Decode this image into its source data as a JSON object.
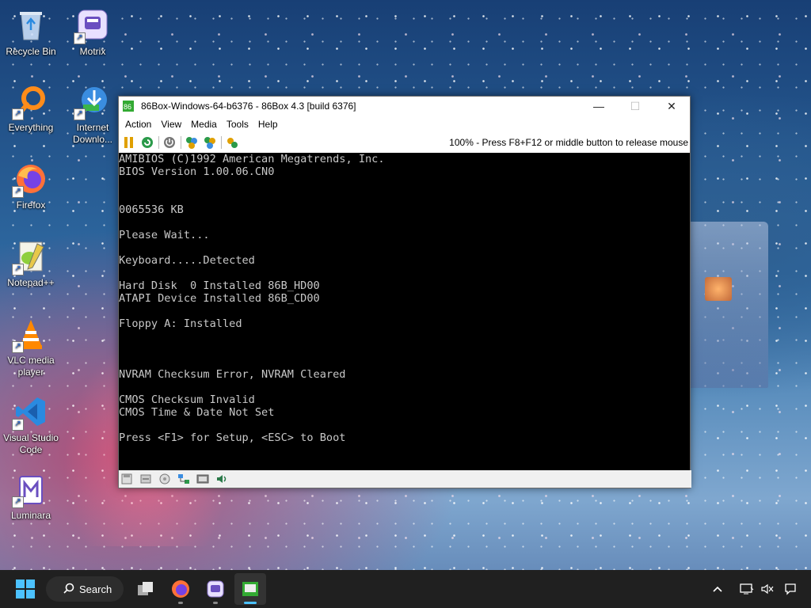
{
  "desktop": {
    "icons": [
      {
        "label": "Recycle Bin",
        "icon": "recycle-bin-icon"
      },
      {
        "label": "Motrix",
        "icon": "motrix-icon"
      },
      {
        "label": "Everything",
        "icon": "everything-search-icon"
      },
      {
        "label": "Internet Downlo...",
        "icon": "internet-download-manager-icon"
      },
      {
        "label": "Firefox",
        "icon": "firefox-icon"
      },
      {
        "label": "Notepad++",
        "icon": "notepadpp-icon"
      },
      {
        "label": "VLC media player",
        "icon": "vlc-icon"
      },
      {
        "label": "Visual Studio Code",
        "icon": "vscode-icon"
      },
      {
        "label": "Luminara",
        "icon": "luminara-icon"
      }
    ]
  },
  "window": {
    "title": "86Box-Windows-64-b6376 - 86Box 4.3 [build 6376]",
    "controls": {
      "minimize": "—",
      "maximize": "☐",
      "close": "✕"
    },
    "menu": [
      "Action",
      "View",
      "Media",
      "Tools",
      "Help"
    ],
    "toolbar": {
      "buttons": [
        "pause-icon",
        "reset-icon",
        "power-icon",
        "ctrl-alt-del-icon",
        "ctrl-alt-esc-icon",
        "settings-icon"
      ],
      "status": "100% - Press F8+F12 or middle button to release mouse"
    },
    "screen_lines": [
      "AMIBIOS (C)1992 American Megatrends, Inc.",
      "BIOS Version 1.00.06.CN0",
      "",
      "",
      "0065536 KB",
      "",
      "Please Wait...",
      "",
      "Keyboard.....Detected",
      "",
      "Hard Disk  0 Installed 86B_HD00",
      "ATAPI Device Installed 86B_CD00",
      "",
      "Floppy A: Installed",
      "",
      "",
      "",
      "NVRAM Checksum Error, NVRAM Cleared",
      "",
      "CMOS Checksum Invalid",
      "CMOS Time & Date Not Set",
      "",
      "Press <F1> for Setup, <ESC> to Boot"
    ],
    "statusbar_icons": [
      "floppy-icon",
      "cdrom-icon",
      "hdd-icon",
      "network-icon",
      "display-icon",
      "sound-icon"
    ]
  },
  "taskbar": {
    "search_label": "Search",
    "apps": [
      "task-view-icon",
      "firefox-icon",
      "motrix-icon",
      "86box-icon"
    ],
    "tray": [
      "chevron-up-icon",
      "network-icon",
      "volume-muted-icon",
      "notification-icon"
    ]
  },
  "colors": {
    "taskbar": "#202020",
    "accent": "#4cc2ff",
    "screen_text": "#c8c8c8"
  }
}
